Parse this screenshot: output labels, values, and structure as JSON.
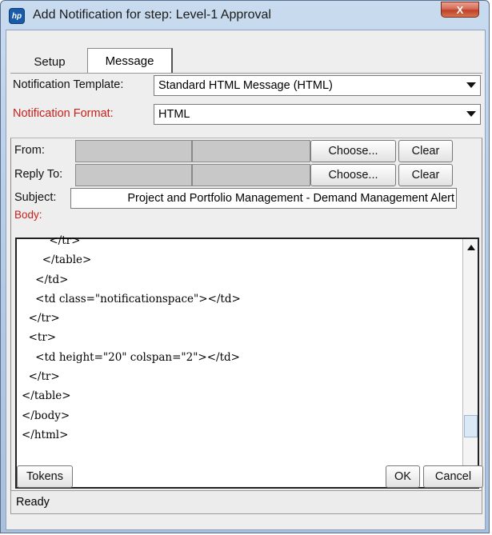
{
  "window": {
    "title": "Add Notification for step: Level-1 Approval",
    "app_icon_text": "hp",
    "close_symbol": "X",
    "icons": {
      "app": "hp-logo-icon",
      "close": "close-icon"
    }
  },
  "tabs": [
    {
      "label": "Setup",
      "selected": false
    },
    {
      "label": "Message",
      "selected": true
    }
  ],
  "form": {
    "template_label": "Notification Template:",
    "template_value": "Standard HTML Message (HTML)",
    "format_label": "Notification Format:",
    "format_value": "HTML",
    "from_label": "From:",
    "reply_to_label": "Reply To:",
    "choose_label": "Choose...",
    "clear_label": "Clear",
    "subject_label": "Subject:",
    "subject_value": "Project and Portfolio Management - Demand Management Alert",
    "body_label": "Body:",
    "required_color": "#c8211b"
  },
  "body_lines": [
    "        </tr>",
    "      </table>",
    "    </td>",
    "    <td class=\"notificationspace\"></td>",
    "  </tr>",
    "  <tr>",
    "    <td height=\"20\" colspan=\"2\"></td>",
    "  </tr>",
    "</table>",
    "</body>",
    "</html>"
  ],
  "buttons": {
    "tokens": "Tokens",
    "ok": "OK",
    "cancel": "Cancel"
  },
  "status": "Ready"
}
